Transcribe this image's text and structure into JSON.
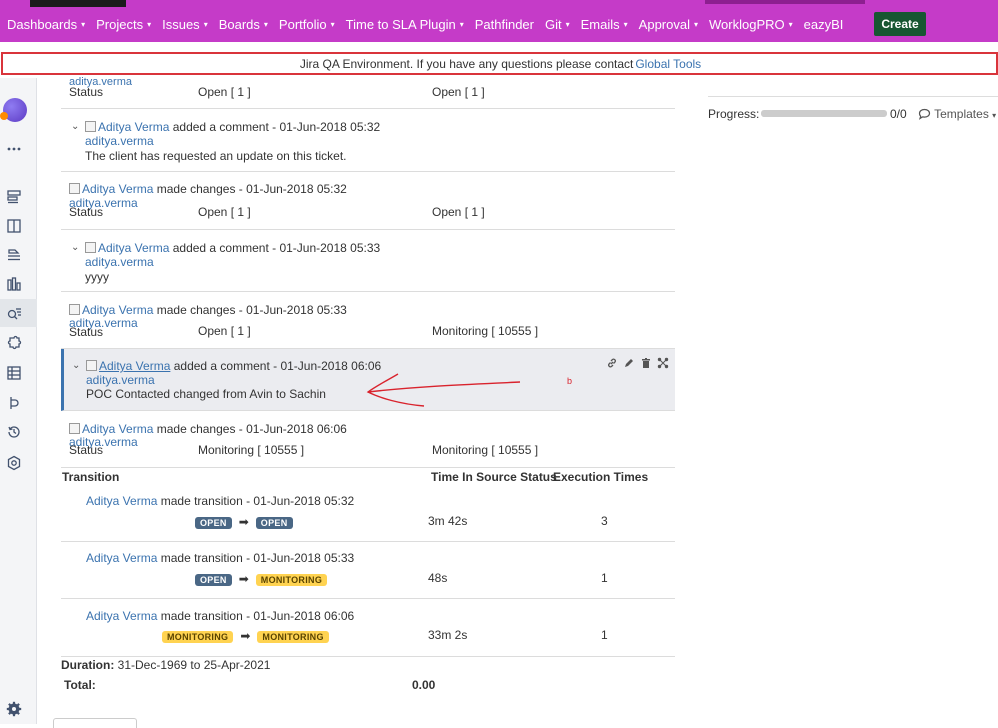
{
  "nav": {
    "items": [
      {
        "label": "Dashboards",
        "caret": true
      },
      {
        "label": "Projects",
        "caret": true
      },
      {
        "label": "Issues",
        "caret": true
      },
      {
        "label": "Boards",
        "caret": true
      },
      {
        "label": "Portfolio",
        "caret": true
      },
      {
        "label": "Time to SLA Plugin",
        "caret": true
      },
      {
        "label": "Pathfinder",
        "caret": false
      },
      {
        "label": "Git",
        "caret": true
      },
      {
        "label": "Emails",
        "caret": true
      },
      {
        "label": "Approval",
        "caret": true
      },
      {
        "label": "WorklogPRO",
        "caret": true
      },
      {
        "label": "eazyBI",
        "caret": false
      }
    ],
    "create_label": "Create",
    "caret_glyph": "▾"
  },
  "banner": {
    "text": "Jira QA Environment. If you have any questions please contact",
    "link": "Global Tools"
  },
  "activity": {
    "entries": [
      {
        "type": "change",
        "user_id": "aditya.verma",
        "field": "Status",
        "from": "Open [ 1 ]",
        "to": "Open [ 1 ]"
      },
      {
        "type": "comment",
        "user": "Aditya Verma",
        "action": "added a comment - 01-Jun-2018 05:32",
        "user_id": "aditya.verma",
        "body": "The client has requested an update on this ticket."
      },
      {
        "type": "change",
        "user": "Aditya Verma",
        "action": "made changes - 01-Jun-2018 05:32",
        "user_id": "aditya.verma",
        "field": "Status",
        "from": "Open [ 1 ]",
        "to": "Open [ 1 ]"
      },
      {
        "type": "comment",
        "user": "Aditya Verma",
        "action": "added a comment - 01-Jun-2018 05:33",
        "user_id": "aditya.verma",
        "body": "yyyy"
      },
      {
        "type": "change",
        "user": "Aditya Verma",
        "action": "made changes - 01-Jun-2018 05:33",
        "user_id": "aditya.verma",
        "field": "Status",
        "from": "Open [ 1 ]",
        "to": "Monitoring [ 10555 ]"
      },
      {
        "type": "comment",
        "user": "Aditya Verma",
        "action": "added a comment - 01-Jun-2018 06:06",
        "user_id": "aditya.verma",
        "body": "POC Contacted changed from Avin to Sachin"
      },
      {
        "type": "change",
        "user": "Aditya Verma",
        "action": "made changes - 01-Jun-2018 06:06",
        "user_id": "aditya.verma",
        "field": "Status",
        "from": "Monitoring [ 10555 ]",
        "to": "Monitoring [ 10555 ]"
      }
    ],
    "annotation_mark": "b"
  },
  "transitions": {
    "headers": {
      "transition": "Transition",
      "time": "Time In Source Status",
      "exec": "Execution Times"
    },
    "rows": [
      {
        "user": "Aditya Verma",
        "action": "made transition - 01-Jun-2018 05:32",
        "from": "OPEN",
        "to": "OPEN",
        "time": "3m 42s",
        "times": "3"
      },
      {
        "user": "Aditya Verma",
        "action": "made transition - 01-Jun-2018 05:33",
        "from": "OPEN",
        "to": "MONITORING",
        "time": "48s",
        "times": "1"
      },
      {
        "user": "Aditya Verma",
        "action": "made transition - 01-Jun-2018 06:06",
        "from": "MONITORING",
        "to": "MONITORING",
        "time": "33m 2s",
        "times": "1"
      }
    ],
    "duration_label": "Duration:",
    "duration_value": "31-Dec-1969 to 25-Apr-2021",
    "total_label": "Total:",
    "total_value": "0.00"
  },
  "right_panel": {
    "progress_label": "Progress:",
    "progress_value": 0,
    "progress_count": "0/0",
    "templates_label": "Templates"
  },
  "colors": {
    "nav_bg": "#c53bc8",
    "create_bg": "#175632",
    "banner_border": "#d9343b",
    "link": "#3b73af",
    "lozenge_open": "#4a6785",
    "lozenge_monitoring": "#ffd351",
    "annotation": "#d9232d"
  }
}
